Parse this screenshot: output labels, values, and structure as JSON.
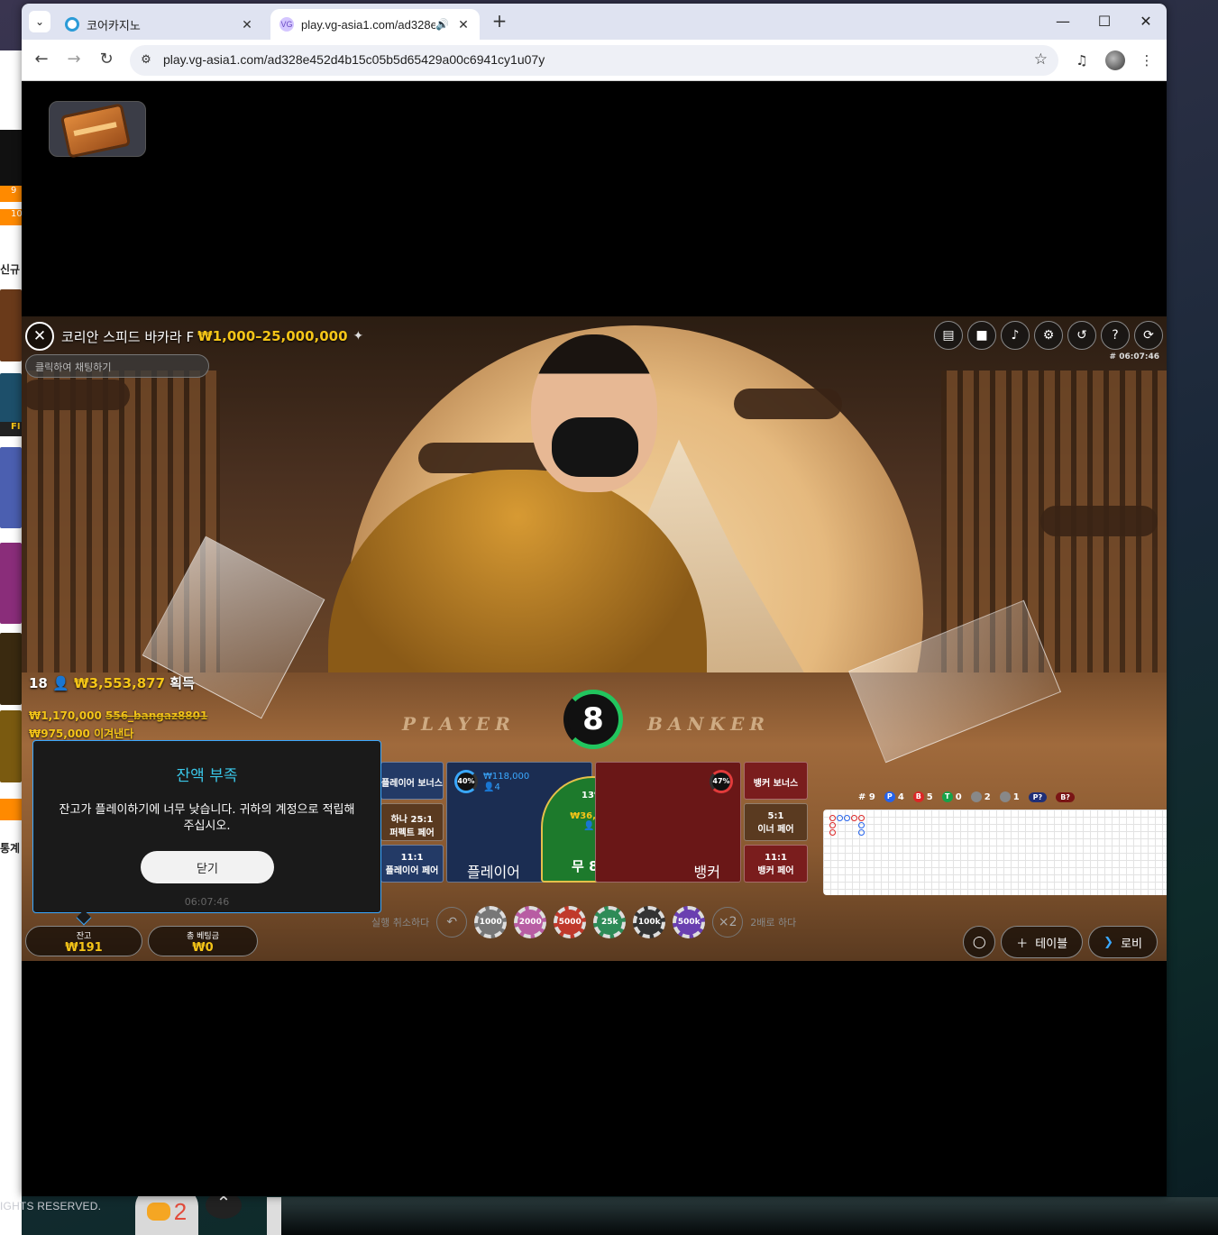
{
  "background": {
    "left_items": [
      "9",
      "10",
      "신규",
      "FI",
      "통계"
    ],
    "footer_text": "IGHTS RESERVED.",
    "chat_count": "2"
  },
  "browser": {
    "tabs": [
      {
        "title": "코어카지노",
        "active": false
      },
      {
        "title": "play.vg-asia1.com/ad328e4",
        "active": true
      }
    ],
    "url": "play.vg-asia1.com/ad328e452d4b15c05b5d65429a00c6941cy1u07y"
  },
  "game": {
    "table_title": "코리안 스피드 바카라 F",
    "table_limit": "₩1,000–25,000,000",
    "chat_placeholder": "클릭하여 채팅하기",
    "game_id": "# 06:07:46",
    "win_summary": {
      "count": "18",
      "amount": "₩3,553,877",
      "suffix": "획득"
    },
    "win_rows": [
      {
        "amount": "₩1,170,000",
        "name": "556_bangaz8801"
      },
      {
        "amount": "₩975,000",
        "name": "이겨낸다"
      }
    ],
    "table_words": {
      "player": "PLAYER",
      "banker": "BANKER"
    },
    "timer": "8",
    "board": {
      "player_bonus": "플레이어 보너스",
      "banker_bonus": "뱅커 보너스",
      "either_perfect_odds": "하나 25:1",
      "either_perfect_label": "퍼펙트 페어",
      "egalite_odds": "5:1",
      "egalite_label": "이너 페어",
      "player_pair_odds": "11:1",
      "player_pair_label": "플레이어 페어",
      "banker_pair_odds": "11:1",
      "banker_pair_label": "뱅커 페어",
      "player_label": "플레이어",
      "banker_label": "뱅커",
      "tie_label": "무 8:1",
      "player_pct": "40%",
      "player_amount": "₩118,000",
      "player_count": "4",
      "banker_pct": "47%",
      "tie_pct": "13%",
      "tie_amount": "₩36,000",
      "tie_count": "3"
    },
    "road_stats": {
      "round": "# 9",
      "p": "4",
      "b": "5",
      "t": "0",
      "pp": "2",
      "bp": "1",
      "p_ask": "P?",
      "b_ask": "B?"
    },
    "chips": {
      "undo_label": "실행 취소하다",
      "double_label": "2배로 하다",
      "double_icon": "×2",
      "values": [
        "1000",
        "2000",
        "5000",
        "25k",
        "100k",
        "500k"
      ]
    },
    "balance": {
      "label": "잔고",
      "value": "₩191"
    },
    "total_bet": {
      "label": "총 베팅금",
      "value": "₩0"
    },
    "table_btn": "테이블",
    "lobby_btn": "로비",
    "modal": {
      "title": "잔액 부족",
      "body": "잔고가 플레이하기에 너무 낮습니다. 귀하의 계정으로 적립해 주십시오.",
      "button": "닫기",
      "time": "06:07:46"
    }
  }
}
